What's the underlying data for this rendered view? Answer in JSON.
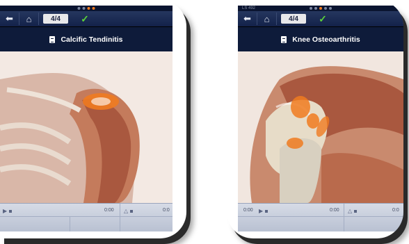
{
  "cards": [
    {
      "toolbar": {
        "page": "4/4"
      },
      "title": "Calcific Tendinitis",
      "controls": {
        "time1": "0:00",
        "time2": "0:0"
      }
    },
    {
      "status": {
        "carrier": "LS 492"
      },
      "toolbar": {
        "page": "4/4"
      },
      "title": "Knee Osteoarthritis",
      "controls": {
        "time1": "0:00",
        "time2": "0:00",
        "time3": "0:0"
      }
    }
  ],
  "colors": {
    "nav": "#0e1b3a",
    "check": "#5bd23a",
    "highlight": "#f07b20"
  },
  "icons": [
    "back-arrow-icon",
    "home-icon",
    "checkmark-icon",
    "document-icon",
    "play-icon"
  ]
}
